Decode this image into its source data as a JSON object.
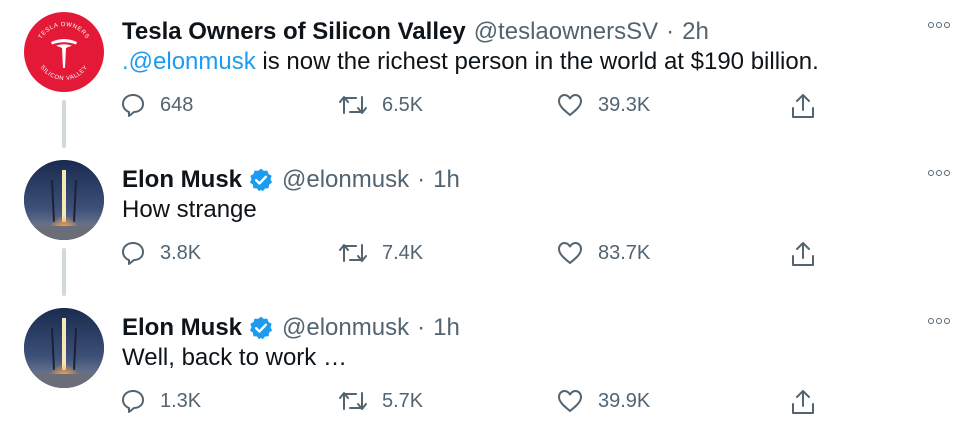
{
  "colors": {
    "link": "#1d9bf0",
    "secondary": "#536471",
    "tesla_red": "#e31937",
    "verified": "#1d9bf0"
  },
  "icons": [
    "reply-icon",
    "retweet-icon",
    "like-icon",
    "share-icon",
    "more-icon",
    "verified-badge-icon"
  ],
  "tweets": [
    {
      "author": "Tesla Owners of Silicon Valley",
      "handle": "@teslaownersSV",
      "separator": "·",
      "time": "2h",
      "text_mention": ".@elonmusk",
      "text_rest": " is now the richest person in the world at $190 billion.",
      "avatar_text_top": "TESLA OWNERS",
      "avatar_text_bottom": "SILICON VALLEY",
      "reply_count": "648",
      "retweet_count": "6.5K",
      "like_count": "39.3K"
    },
    {
      "author": "Elon Musk",
      "handle": "@elonmusk",
      "separator": "·",
      "time": "1h",
      "text": "How strange",
      "reply_count": "3.8K",
      "retweet_count": "7.4K",
      "like_count": "83.7K"
    },
    {
      "author": "Elon Musk",
      "handle": "@elonmusk",
      "separator": "·",
      "time": "1h",
      "text": "Well, back to work …",
      "reply_count": "1.3K",
      "retweet_count": "5.7K",
      "like_count": "39.9K"
    }
  ]
}
